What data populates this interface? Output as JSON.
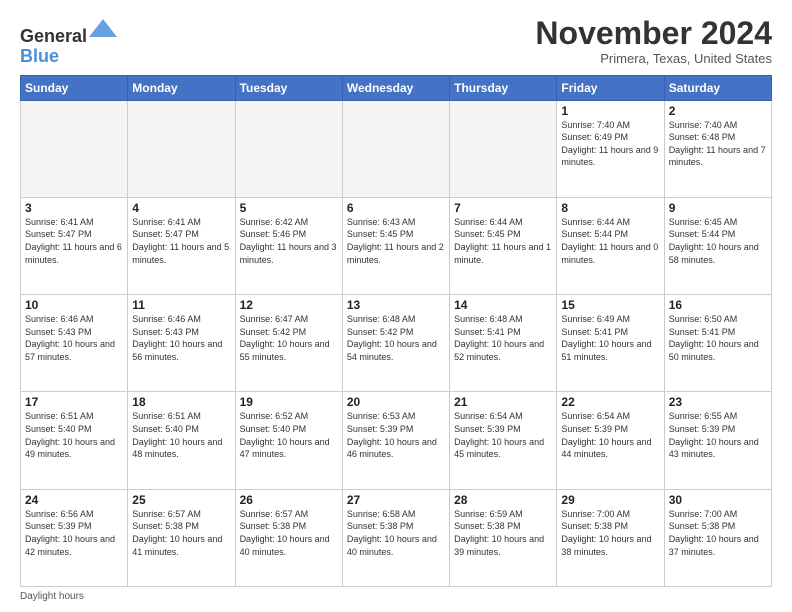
{
  "header": {
    "logo_line1": "General",
    "logo_line2": "Blue",
    "month_title": "November 2024",
    "location": "Primera, Texas, United States"
  },
  "weekdays": [
    "Sunday",
    "Monday",
    "Tuesday",
    "Wednesday",
    "Thursday",
    "Friday",
    "Saturday"
  ],
  "footer": {
    "note": "Daylight hours"
  },
  "weeks": [
    [
      {
        "day": "",
        "sunrise": "",
        "sunset": "",
        "daylight": "",
        "empty": true
      },
      {
        "day": "",
        "sunrise": "",
        "sunset": "",
        "daylight": "",
        "empty": true
      },
      {
        "day": "",
        "sunrise": "",
        "sunset": "",
        "daylight": "",
        "empty": true
      },
      {
        "day": "",
        "sunrise": "",
        "sunset": "",
        "daylight": "",
        "empty": true
      },
      {
        "day": "",
        "sunrise": "",
        "sunset": "",
        "daylight": "",
        "empty": true
      },
      {
        "day": "1",
        "sunrise": "Sunrise: 7:40 AM",
        "sunset": "Sunset: 6:49 PM",
        "daylight": "Daylight: 11 hours and 9 minutes.",
        "empty": false
      },
      {
        "day": "2",
        "sunrise": "Sunrise: 7:40 AM",
        "sunset": "Sunset: 6:48 PM",
        "daylight": "Daylight: 11 hours and 7 minutes.",
        "empty": false
      }
    ],
    [
      {
        "day": "3",
        "sunrise": "Sunrise: 6:41 AM",
        "sunset": "Sunset: 5:47 PM",
        "daylight": "Daylight: 11 hours and 6 minutes.",
        "empty": false
      },
      {
        "day": "4",
        "sunrise": "Sunrise: 6:41 AM",
        "sunset": "Sunset: 5:47 PM",
        "daylight": "Daylight: 11 hours and 5 minutes.",
        "empty": false
      },
      {
        "day": "5",
        "sunrise": "Sunrise: 6:42 AM",
        "sunset": "Sunset: 5:46 PM",
        "daylight": "Daylight: 11 hours and 3 minutes.",
        "empty": false
      },
      {
        "day": "6",
        "sunrise": "Sunrise: 6:43 AM",
        "sunset": "Sunset: 5:45 PM",
        "daylight": "Daylight: 11 hours and 2 minutes.",
        "empty": false
      },
      {
        "day": "7",
        "sunrise": "Sunrise: 6:44 AM",
        "sunset": "Sunset: 5:45 PM",
        "daylight": "Daylight: 11 hours and 1 minute.",
        "empty": false
      },
      {
        "day": "8",
        "sunrise": "Sunrise: 6:44 AM",
        "sunset": "Sunset: 5:44 PM",
        "daylight": "Daylight: 11 hours and 0 minutes.",
        "empty": false
      },
      {
        "day": "9",
        "sunrise": "Sunrise: 6:45 AM",
        "sunset": "Sunset: 5:44 PM",
        "daylight": "Daylight: 10 hours and 58 minutes.",
        "empty": false
      }
    ],
    [
      {
        "day": "10",
        "sunrise": "Sunrise: 6:46 AM",
        "sunset": "Sunset: 5:43 PM",
        "daylight": "Daylight: 10 hours and 57 minutes.",
        "empty": false
      },
      {
        "day": "11",
        "sunrise": "Sunrise: 6:46 AM",
        "sunset": "Sunset: 5:43 PM",
        "daylight": "Daylight: 10 hours and 56 minutes.",
        "empty": false
      },
      {
        "day": "12",
        "sunrise": "Sunrise: 6:47 AM",
        "sunset": "Sunset: 5:42 PM",
        "daylight": "Daylight: 10 hours and 55 minutes.",
        "empty": false
      },
      {
        "day": "13",
        "sunrise": "Sunrise: 6:48 AM",
        "sunset": "Sunset: 5:42 PM",
        "daylight": "Daylight: 10 hours and 54 minutes.",
        "empty": false
      },
      {
        "day": "14",
        "sunrise": "Sunrise: 6:48 AM",
        "sunset": "Sunset: 5:41 PM",
        "daylight": "Daylight: 10 hours and 52 minutes.",
        "empty": false
      },
      {
        "day": "15",
        "sunrise": "Sunrise: 6:49 AM",
        "sunset": "Sunset: 5:41 PM",
        "daylight": "Daylight: 10 hours and 51 minutes.",
        "empty": false
      },
      {
        "day": "16",
        "sunrise": "Sunrise: 6:50 AM",
        "sunset": "Sunset: 5:41 PM",
        "daylight": "Daylight: 10 hours and 50 minutes.",
        "empty": false
      }
    ],
    [
      {
        "day": "17",
        "sunrise": "Sunrise: 6:51 AM",
        "sunset": "Sunset: 5:40 PM",
        "daylight": "Daylight: 10 hours and 49 minutes.",
        "empty": false
      },
      {
        "day": "18",
        "sunrise": "Sunrise: 6:51 AM",
        "sunset": "Sunset: 5:40 PM",
        "daylight": "Daylight: 10 hours and 48 minutes.",
        "empty": false
      },
      {
        "day": "19",
        "sunrise": "Sunrise: 6:52 AM",
        "sunset": "Sunset: 5:40 PM",
        "daylight": "Daylight: 10 hours and 47 minutes.",
        "empty": false
      },
      {
        "day": "20",
        "sunrise": "Sunrise: 6:53 AM",
        "sunset": "Sunset: 5:39 PM",
        "daylight": "Daylight: 10 hours and 46 minutes.",
        "empty": false
      },
      {
        "day": "21",
        "sunrise": "Sunrise: 6:54 AM",
        "sunset": "Sunset: 5:39 PM",
        "daylight": "Daylight: 10 hours and 45 minutes.",
        "empty": false
      },
      {
        "day": "22",
        "sunrise": "Sunrise: 6:54 AM",
        "sunset": "Sunset: 5:39 PM",
        "daylight": "Daylight: 10 hours and 44 minutes.",
        "empty": false
      },
      {
        "day": "23",
        "sunrise": "Sunrise: 6:55 AM",
        "sunset": "Sunset: 5:39 PM",
        "daylight": "Daylight: 10 hours and 43 minutes.",
        "empty": false
      }
    ],
    [
      {
        "day": "24",
        "sunrise": "Sunrise: 6:56 AM",
        "sunset": "Sunset: 5:39 PM",
        "daylight": "Daylight: 10 hours and 42 minutes.",
        "empty": false
      },
      {
        "day": "25",
        "sunrise": "Sunrise: 6:57 AM",
        "sunset": "Sunset: 5:38 PM",
        "daylight": "Daylight: 10 hours and 41 minutes.",
        "empty": false
      },
      {
        "day": "26",
        "sunrise": "Sunrise: 6:57 AM",
        "sunset": "Sunset: 5:38 PM",
        "daylight": "Daylight: 10 hours and 40 minutes.",
        "empty": false
      },
      {
        "day": "27",
        "sunrise": "Sunrise: 6:58 AM",
        "sunset": "Sunset: 5:38 PM",
        "daylight": "Daylight: 10 hours and 40 minutes.",
        "empty": false
      },
      {
        "day": "28",
        "sunrise": "Sunrise: 6:59 AM",
        "sunset": "Sunset: 5:38 PM",
        "daylight": "Daylight: 10 hours and 39 minutes.",
        "empty": false
      },
      {
        "day": "29",
        "sunrise": "Sunrise: 7:00 AM",
        "sunset": "Sunset: 5:38 PM",
        "daylight": "Daylight: 10 hours and 38 minutes.",
        "empty": false
      },
      {
        "day": "30",
        "sunrise": "Sunrise: 7:00 AM",
        "sunset": "Sunset: 5:38 PM",
        "daylight": "Daylight: 10 hours and 37 minutes.",
        "empty": false
      }
    ]
  ]
}
